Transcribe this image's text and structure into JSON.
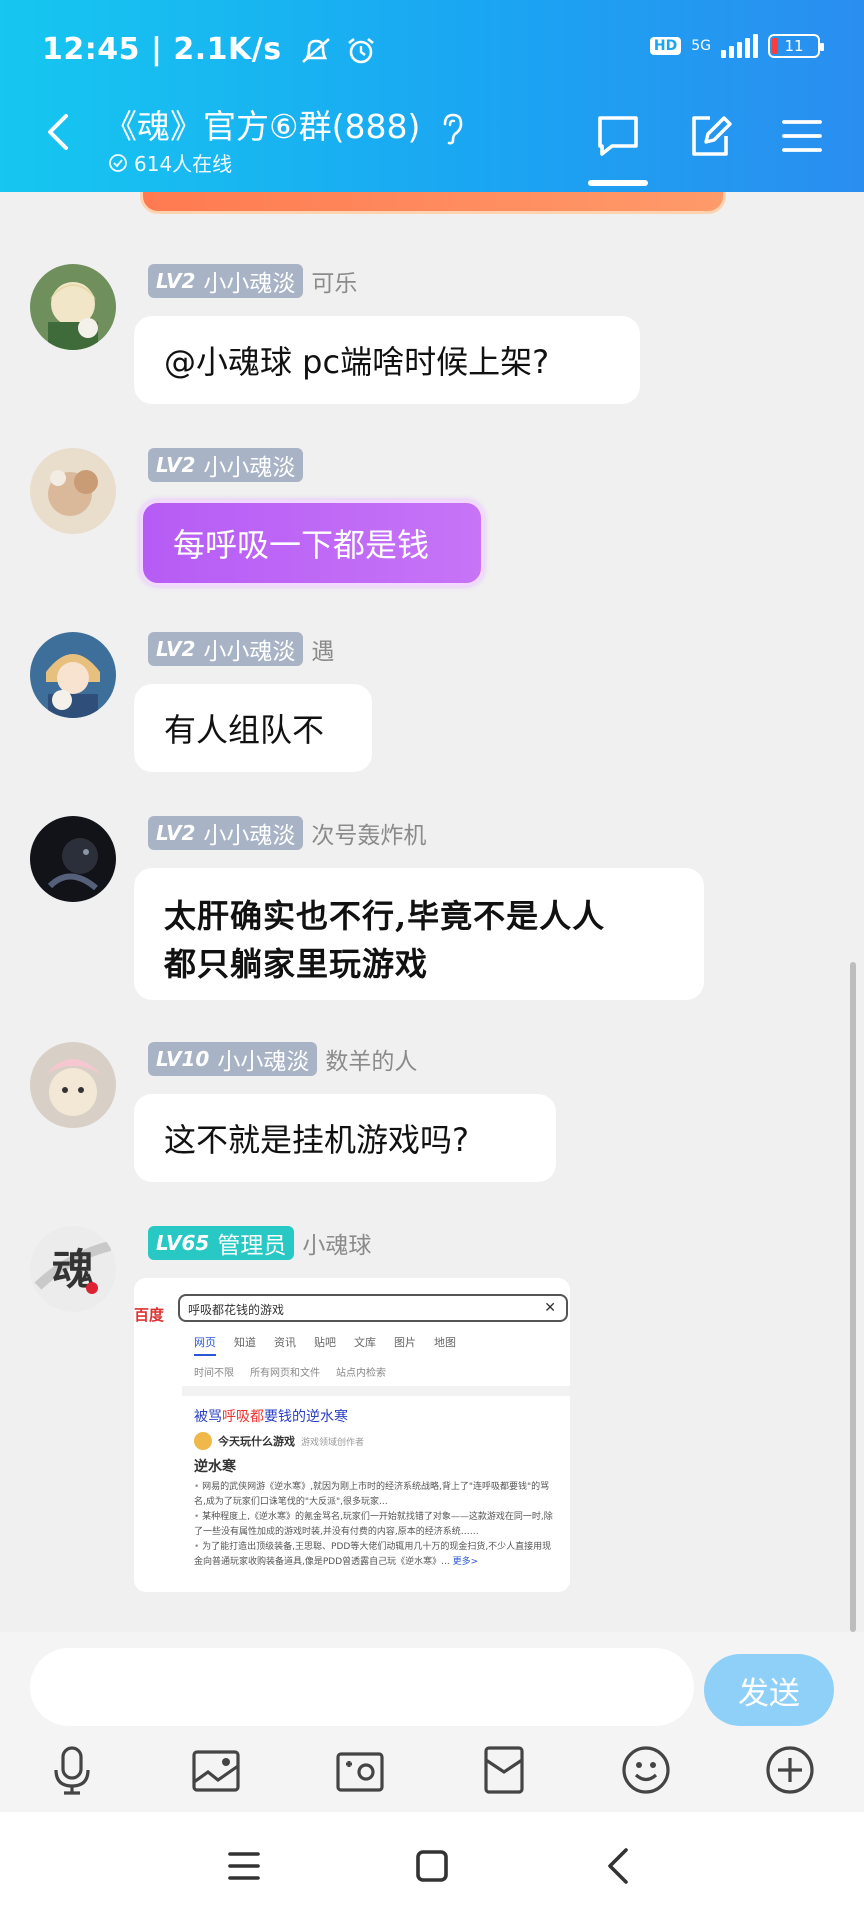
{
  "status": {
    "time": "12:45 | 2.1K/s",
    "hd": "HD",
    "network": "5G",
    "battery": "11"
  },
  "header": {
    "title": "《魂》官方⑥群(888)",
    "online": "614人在线"
  },
  "messages": [
    {
      "level": "LV2",
      "rank": "小小魂淡",
      "nick": "可乐",
      "text": "@小魂球 pc端啥时候上架?"
    },
    {
      "level": "LV2",
      "rank": "小小魂淡",
      "nick": "",
      "text": "每呼吸一下都是钱"
    },
    {
      "level": "LV2",
      "rank": "小小魂淡",
      "nick": "遇",
      "text": "有人组队不"
    },
    {
      "level": "LV2",
      "rank": "小小魂淡",
      "nick": "次号轰炸机",
      "text_line1": "太肝确实也不行,毕竟不是人人",
      "text_line2": "都只躺家里玩游戏"
    },
    {
      "level": "LV10",
      "rank": "小小魂淡",
      "nick": "数羊的人",
      "text": "这不就是挂机游戏吗?"
    },
    {
      "level": "LV65",
      "rank": "管理员",
      "nick": "小魂球",
      "avatar_text": "魂"
    }
  ],
  "screenshot": {
    "logo": "百度",
    "query": "呼吸都花钱的游戏",
    "tabs": [
      "网页",
      "知道",
      "资讯",
      "贴吧",
      "文库",
      "图片",
      "地图"
    ],
    "filters": [
      "时间不限",
      "所有网页和文件",
      "站点内检索"
    ],
    "result_title_pre": "被骂",
    "result_title_em": "呼吸都",
    "result_title_post": "要钱的逆水寒",
    "author": "今天玩什么游戏",
    "author_tag": "游戏领域创作者",
    "heading": "逆水寒",
    "p1": "网易的武侠网游《逆水寒》,就因为刚上市时的经济系统战略,背上了\"连呼吸都要钱\"的骂名,成为了玩家们口诛笔伐的\"大反派\",很多玩家...",
    "p2": "某种程度上,《逆水寒》的氪金骂名,玩家们一开始就找错了对象——这款游戏在同一时,除了一些没有属性加成的游戏时装,并没有付费的内容,原本的经济系统……",
    "p3": "为了能打造出顶级装备,王思聪、PDD等大佬们动辄用几十万的现金扫货,不少人直接用现金向普通玩家收购装备道具,像是PDD曾透露自己玩《逆水寒》...",
    "more": "更多>"
  },
  "input": {
    "send": "发送"
  }
}
